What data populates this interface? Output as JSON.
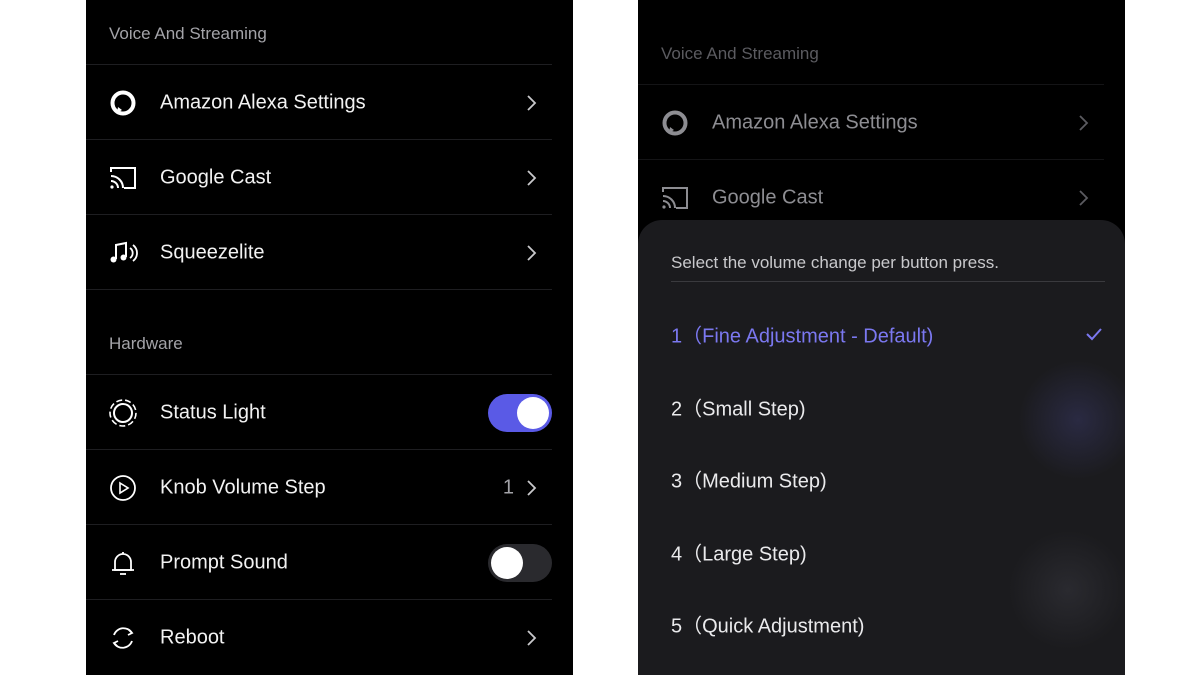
{
  "left": {
    "sections": [
      {
        "header": "Voice And Streaming",
        "rows": [
          {
            "label": "Amazon Alexa Settings",
            "icon": "alexa-icon"
          },
          {
            "label": "Google Cast",
            "icon": "cast-icon"
          },
          {
            "label": "Squeezelite",
            "icon": "music-note-icon"
          }
        ]
      },
      {
        "header": "Hardware",
        "rows": [
          {
            "label": "Status Light",
            "icon": "status-light-icon",
            "toggle": true
          },
          {
            "label": "Knob Volume Step",
            "icon": "play-circle-icon",
            "value": "1"
          },
          {
            "label": "Prompt Sound",
            "icon": "bell-icon",
            "toggle": false
          },
          {
            "label": "Reboot",
            "icon": "reboot-icon"
          }
        ]
      }
    ]
  },
  "right": {
    "background": {
      "header": "Voice And Streaming",
      "rows": [
        {
          "label": "Amazon Alexa Settings",
          "icon": "alexa-icon"
        },
        {
          "label": "Google Cast",
          "icon": "cast-icon"
        }
      ]
    },
    "sheet": {
      "title": "Select the volume change per button press.",
      "options": [
        {
          "label": "1（Fine Adjustment - Default)",
          "selected": true
        },
        {
          "label": "2（Small Step)",
          "selected": false
        },
        {
          "label": "3（Medium Step)",
          "selected": false
        },
        {
          "label": "4（Large Step)",
          "selected": false
        },
        {
          "label": "5（Quick Adjustment)",
          "selected": false
        }
      ]
    }
  },
  "colors": {
    "accent": "#5a5ae6",
    "selected_text": "#7b78f0",
    "background": "#000000",
    "sheet": "#1b1b1e"
  }
}
